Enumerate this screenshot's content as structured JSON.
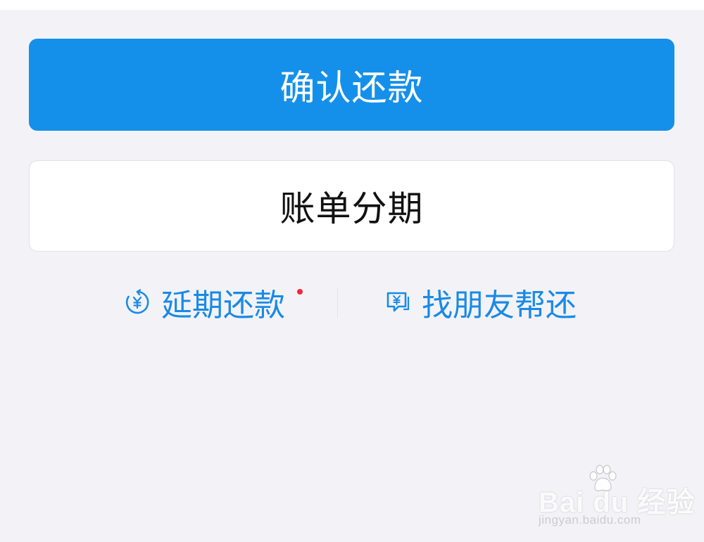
{
  "actions": {
    "confirm_repay_label": "确认还款",
    "bill_installment_label": "账单分期"
  },
  "links": {
    "extend_repay_label": "延期还款",
    "friend_repay_label": "找朋友帮还",
    "extend_icon": "clock-yuan-icon",
    "friend_icon": "chat-yuan-icon",
    "has_new_badge": true
  },
  "watermark": {
    "brand": "Bai du 经验",
    "url": "jingyan.baidu.com"
  },
  "colors": {
    "primary": "#1590ea",
    "link": "#1a8ae6",
    "badge": "#f0283a",
    "background": "#f3f3f7"
  }
}
